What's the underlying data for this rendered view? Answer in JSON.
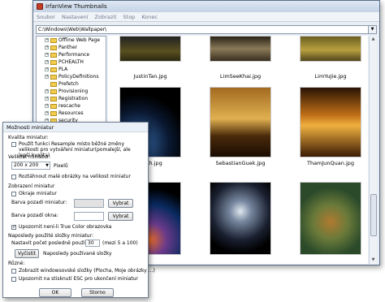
{
  "window": {
    "title": "IrfanView Thumbnails"
  },
  "menu": [
    "Soubor",
    "Nastavení",
    "Zobrazit",
    "Stop",
    "Konec"
  ],
  "path": "C:\\Windows\\Web\\Wallpaper\\",
  "tree": [
    {
      "label": "Offline Web Page",
      "expand": "+"
    },
    {
      "label": "Panther",
      "expand": "+"
    },
    {
      "label": "Performance",
      "expand": "+"
    },
    {
      "label": "PCHEALTH",
      "expand": "+"
    },
    {
      "label": "PLA",
      "expand": "+"
    },
    {
      "label": "PolicyDefinitions",
      "expand": "+"
    },
    {
      "label": "Prefetch",
      "expand": ""
    },
    {
      "label": "Provisioning",
      "expand": "+"
    },
    {
      "label": "Registration",
      "expand": "+"
    },
    {
      "label": "rescache",
      "expand": "+"
    },
    {
      "label": "Resources",
      "expand": "+"
    },
    {
      "label": "security",
      "expand": "+"
    }
  ],
  "thumbnails": [
    {
      "name": "JustinTan.jpg"
    },
    {
      "name": "LimSeeKhai.jpg"
    },
    {
      "name": "LimYuJie.jpg"
    },
    {
      "name": "Earth.jpg"
    },
    {
      "name": "SebastianGuek.jpg"
    },
    {
      "name": "ThamJunQuan.jpg"
    },
    {
      "name": ""
    },
    {
      "name": ""
    },
    {
      "name": ""
    }
  ],
  "dialog": {
    "title": "Možnosti miniatur",
    "quality_heading": "Kvalita miniatur:",
    "resample_label": "Použít funkci Resample místo běžné změny velikosti pro vytváření miniatur(pomalejší, ale lepší kvalita)",
    "size_heading": "Velikost miniatur:",
    "size_value": "200 x 200",
    "size_unit": "Pixelů",
    "enlarge_label": "Roztáhnout malé obrázky na velikost miniatur",
    "display_heading": "Zobrazení miniatur",
    "frame_label": "Okraje miniatur",
    "bgcolor_label": "Barva pozadí miniatur:",
    "wincolor_label": "Barva pozadí okna:",
    "choose_label": "Vybrat",
    "truecolor_label": "Upozornit není-li True Color obrazovka",
    "recent_heading": "Naposledy použité složky miniatur:",
    "recent_count_label": "Nastavit počet posledně použitých:",
    "recent_count_value": "30",
    "recent_range": "(mezi 5 a 100)",
    "clear_label": "Vyčistit",
    "recent_folders_label": "Naposledy používané složky",
    "misc_heading": "Různé:",
    "winfolders_label": "Zobrazit windowsovské složky (Plocha, Moje obrázky ...)",
    "esc_label": "Upozornit na stisknutí ESC pro ukončení miniatur",
    "ok_label": "OK",
    "cancel_label": "Storno"
  }
}
